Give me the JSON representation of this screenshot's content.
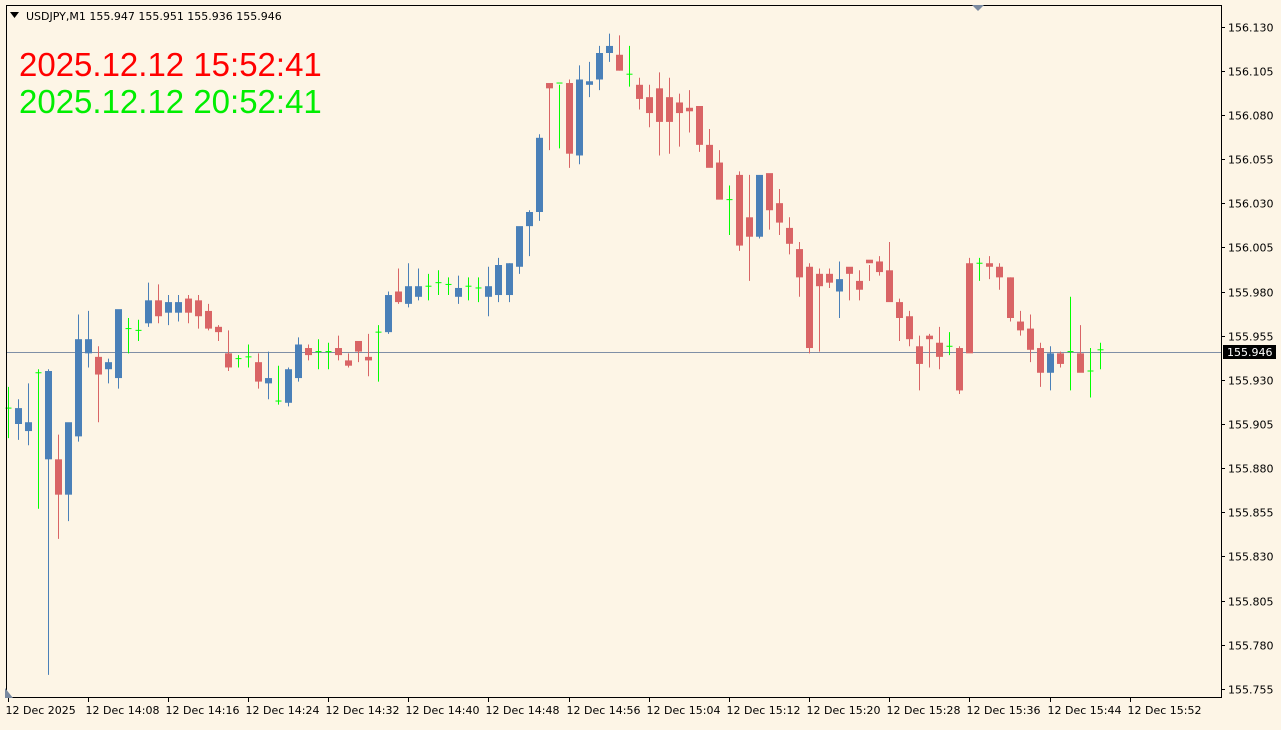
{
  "colors": {
    "background": "#fdf5e6",
    "axis": "#000000",
    "bull": "#4a80b8",
    "bear": "#d96465",
    "doji": "#00ff00",
    "bid_line": "#7f8fa6",
    "price_tag_bg": "#000000",
    "price_tag_text": "#ffffff",
    "clock_1": "#ff0000",
    "clock_2": "#00ee00"
  },
  "header": {
    "symbol_text": "USDJPY,M1  155.947 155.951 155.936 155.946",
    "menu_icon": "triangle-down-icon"
  },
  "clocks": {
    "time_1": "2025.12.12 15:52:41",
    "time_2": "2025.12.12 20:52:41"
  },
  "current_price": "155.946",
  "chart_data": {
    "type": "candlestick",
    "symbol": "USDJPY",
    "timeframe": "M1",
    "ylim": [
      155.755,
      156.136
    ],
    "y_ticks": [
      "156.130",
      "156.105",
      "156.080",
      "156.055",
      "156.030",
      "156.005",
      "155.980",
      "155.955",
      "155.930",
      "155.905",
      "155.880",
      "155.855",
      "155.830",
      "155.805",
      "155.780",
      "155.755"
    ],
    "x_ticks": [
      {
        "label": "12 Dec 2025",
        "index": 0
      },
      {
        "label": "12 Dec 14:08",
        "index": 8
      },
      {
        "label": "12 Dec 14:16",
        "index": 16
      },
      {
        "label": "12 Dec 14:24",
        "index": 24
      },
      {
        "label": "12 Dec 14:32",
        "index": 32
      },
      {
        "label": "12 Dec 14:40",
        "index": 40
      },
      {
        "label": "12 Dec 14:48",
        "index": 48
      },
      {
        "label": "12 Dec 14:56",
        "index": 56
      },
      {
        "label": "12 Dec 15:04",
        "index": 64
      },
      {
        "label": "12 Dec 15:12",
        "index": 72
      },
      {
        "label": "12 Dec 15:20",
        "index": 80
      },
      {
        "label": "12 Dec 15:28",
        "index": 88
      },
      {
        "label": "12 Dec 15:36",
        "index": 96
      },
      {
        "label": "12 Dec 15:44",
        "index": 104
      },
      {
        "label": "12 Dec 15:52",
        "index": 112
      }
    ],
    "last_price": 155.946,
    "candles": [
      [
        155.914,
        155.926,
        155.897,
        155.914
      ],
      [
        155.905,
        155.919,
        155.896,
        155.914
      ],
      [
        155.901,
        155.928,
        155.893,
        155.906
      ],
      [
        155.934,
        155.936,
        155.857,
        155.934
      ],
      [
        155.885,
        155.936,
        155.763,
        155.935
      ],
      [
        155.885,
        155.899,
        155.84,
        155.865
      ],
      [
        155.865,
        155.902,
        155.85,
        155.906
      ],
      [
        155.898,
        155.967,
        155.895,
        155.953
      ],
      [
        155.945,
        155.969,
        155.937,
        155.953
      ],
      [
        155.943,
        155.949,
        155.906,
        155.933
      ],
      [
        155.936,
        155.942,
        155.928,
        155.94
      ],
      [
        155.931,
        155.967,
        155.925,
        155.97
      ],
      [
        155.958,
        155.965,
        155.945,
        155.959
      ],
      [
        155.958,
        155.964,
        155.952,
        155.958
      ],
      [
        155.962,
        155.985,
        155.96,
        155.975
      ],
      [
        155.975,
        155.984,
        155.962,
        155.966
      ],
      [
        155.968,
        155.978,
        155.961,
        155.974
      ],
      [
        155.968,
        155.978,
        155.963,
        155.974
      ],
      [
        155.976,
        155.978,
        155.962,
        155.968
      ],
      [
        155.975,
        155.978,
        155.959,
        155.966
      ],
      [
        155.969,
        155.973,
        155.958,
        155.959
      ],
      [
        155.96,
        155.961,
        155.952,
        155.957
      ],
      [
        155.945,
        155.958,
        155.935,
        155.937
      ],
      [
        155.941,
        155.944,
        155.937,
        155.942
      ],
      [
        155.943,
        155.95,
        155.937,
        155.943
      ],
      [
        155.94,
        155.945,
        155.925,
        155.929
      ],
      [
        155.928,
        155.946,
        155.919,
        155.931
      ],
      [
        155.918,
        155.938,
        155.916,
        155.917
      ],
      [
        155.917,
        155.937,
        155.915,
        155.936
      ],
      [
        155.931,
        155.954,
        155.929,
        155.95
      ],
      [
        155.948,
        155.95,
        155.941,
        155.944
      ],
      [
        155.945,
        155.953,
        155.936,
        155.946
      ],
      [
        155.946,
        155.951,
        155.936,
        155.945
      ],
      [
        155.948,
        155.955,
        155.941,
        155.944
      ],
      [
        155.941,
        155.945,
        155.937,
        155.938
      ],
      [
        155.952,
        155.952,
        155.94,
        155.946
      ],
      [
        155.943,
        155.956,
        155.932,
        155.941
      ],
      [
        155.957,
        155.961,
        155.929,
        155.957
      ],
      [
        155.957,
        155.98,
        155.956,
        155.978
      ],
      [
        155.98,
        155.993,
        155.973,
        155.974
      ],
      [
        155.973,
        155.996,
        155.971,
        155.983
      ],
      [
        155.977,
        155.993,
        155.975,
        155.983
      ],
      [
        155.982,
        155.99,
        155.975,
        155.983
      ],
      [
        155.984,
        155.992,
        155.978,
        155.985
      ],
      [
        155.984,
        155.988,
        155.978,
        155.983
      ],
      [
        155.977,
        155.989,
        155.973,
        155.982
      ],
      [
        155.983,
        155.988,
        155.975,
        155.982
      ],
      [
        155.982,
        155.988,
        155.974,
        155.982
      ],
      [
        155.977,
        155.994,
        155.966,
        155.983
      ],
      [
        155.978,
        155.999,
        155.974,
        155.995
      ],
      [
        155.978,
        155.996,
        155.974,
        155.996
      ],
      [
        155.994,
        156.015,
        155.99,
        156.017
      ],
      [
        156.017,
        156.026,
        156.0,
        156.025
      ],
      [
        156.025,
        156.069,
        156.02,
        156.067
      ],
      [
        156.098,
        156.097,
        156.06,
        156.095
      ],
      [
        156.098,
        156.097,
        156.061,
        156.098
      ],
      [
        156.098,
        156.1,
        156.05,
        156.058
      ],
      [
        156.057,
        156.108,
        156.052,
        156.1
      ],
      [
        156.097,
        156.11,
        156.09,
        156.099
      ],
      [
        156.1,
        156.119,
        156.094,
        156.115
      ],
      [
        156.115,
        156.126,
        156.11,
        156.119
      ],
      [
        156.114,
        156.125,
        156.105,
        156.105
      ],
      [
        156.103,
        156.119,
        156.096,
        156.103
      ],
      [
        156.097,
        156.101,
        156.083,
        156.089
      ],
      [
        156.09,
        156.097,
        156.073,
        156.081
      ],
      [
        156.095,
        156.104,
        156.057,
        156.076
      ],
      [
        156.09,
        156.101,
        156.058,
        156.076
      ],
      [
        156.087,
        156.092,
        156.062,
        156.081
      ],
      [
        156.084,
        156.094,
        156.07,
        156.082
      ],
      [
        156.085,
        156.084,
        156.059,
        156.063
      ],
      [
        156.063,
        156.072,
        156.051,
        156.05
      ],
      [
        156.053,
        156.06,
        156.033,
        156.032
      ],
      [
        156.032,
        156.04,
        156.012,
        156.032
      ],
      [
        156.046,
        156.048,
        156.003,
        156.006
      ],
      [
        156.022,
        156.046,
        155.986,
        156.011
      ],
      [
        156.011,
        156.044,
        156.01,
        156.046
      ],
      [
        156.047,
        156.046,
        156.015,
        156.026
      ],
      [
        156.03,
        156.038,
        156.012,
        156.019
      ],
      [
        156.016,
        156.022,
        156.001,
        156.007
      ],
      [
        156.004,
        156.008,
        155.977,
        155.988
      ],
      [
        155.994,
        155.996,
        155.945,
        155.948
      ],
      [
        155.99,
        155.993,
        155.946,
        155.983
      ],
      [
        155.99,
        155.993,
        155.982,
        155.985
      ],
      [
        155.98,
        155.997,
        155.965,
        155.987
      ],
      [
        155.994,
        155.991,
        155.975,
        155.99
      ],
      [
        155.986,
        155.992,
        155.975,
        155.981
      ],
      [
        155.998,
        155.995,
        155.986,
        155.996
      ],
      [
        155.997,
        156.0,
        155.989,
        155.991
      ],
      [
        155.992,
        156.008,
        155.98,
        155.974
      ],
      [
        155.974,
        155.976,
        155.952,
        155.965
      ],
      [
        155.966,
        155.969,
        155.949,
        155.953
      ],
      [
        155.949,
        155.955,
        155.924,
        155.939
      ],
      [
        155.955,
        155.956,
        155.937,
        155.953
      ],
      [
        155.951,
        155.96,
        155.936,
        155.943
      ],
      [
        155.949,
        155.957,
        155.944,
        155.949
      ],
      [
        155.948,
        155.949,
        155.922,
        155.924
      ],
      [
        155.996,
        155.999,
        155.946,
        155.945
      ],
      [
        155.996,
        155.999,
        155.986,
        155.995
      ],
      [
        155.996,
        156.0,
        155.987,
        155.994
      ],
      [
        155.994,
        155.996,
        155.981,
        155.988
      ],
      [
        155.988,
        155.988,
        155.963,
        155.965
      ],
      [
        155.963,
        155.969,
        155.955,
        155.958
      ],
      [
        155.959,
        155.967,
        155.94,
        155.947
      ],
      [
        155.948,
        155.951,
        155.926,
        155.934
      ],
      [
        155.934,
        155.949,
        155.924,
        155.945
      ],
      [
        155.945,
        155.946,
        155.937,
        155.939
      ],
      [
        155.946,
        155.977,
        155.924,
        155.945
      ],
      [
        155.945,
        155.961,
        155.935,
        155.934
      ],
      [
        155.934,
        155.948,
        155.92,
        155.935
      ],
      [
        155.947,
        155.951,
        155.936,
        155.946
      ]
    ]
  }
}
